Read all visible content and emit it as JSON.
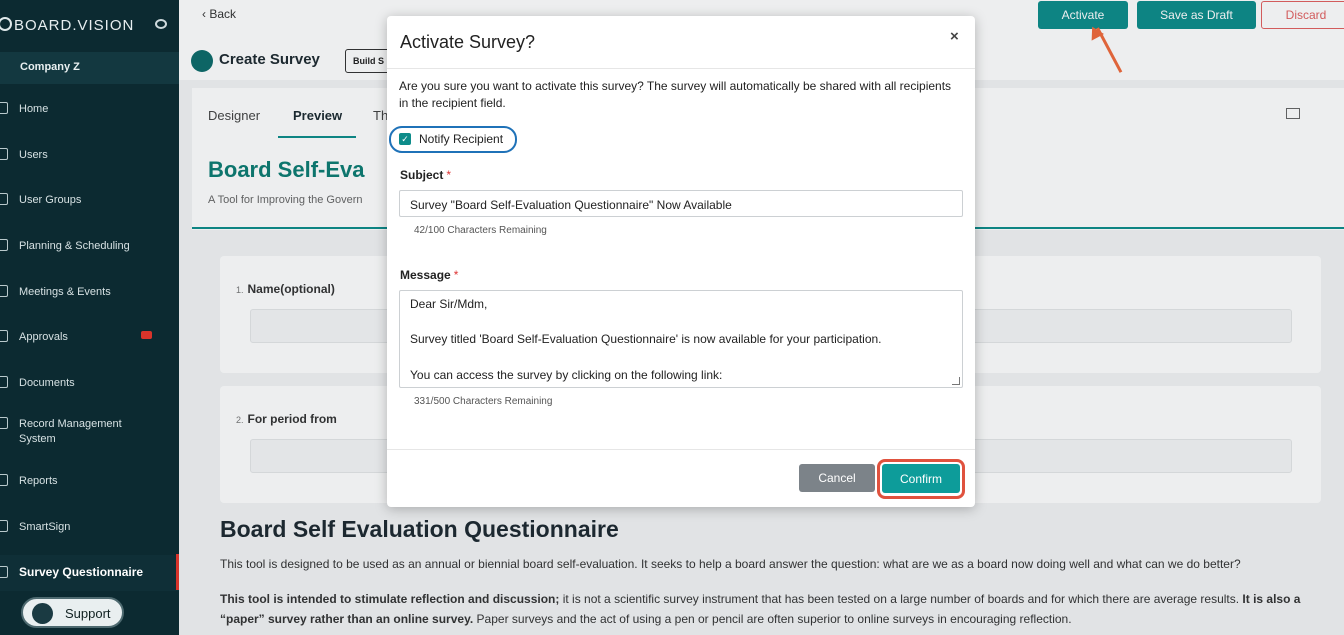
{
  "brand": {
    "name": "BOARD.VISION"
  },
  "sidebar": {
    "company": "Company Z",
    "items": [
      {
        "label": "Home",
        "icon": "home-icon"
      },
      {
        "label": "Users",
        "icon": "user-icon"
      },
      {
        "label": "User Groups",
        "icon": "users-icon"
      },
      {
        "label": "Planning & Scheduling",
        "icon": "chart-icon"
      },
      {
        "label": "Meetings & Events",
        "icon": "calendar-icon"
      },
      {
        "label": "Approvals",
        "icon": "approval-icon",
        "badge": "..."
      },
      {
        "label": "Documents",
        "icon": "document-icon"
      },
      {
        "label": "Record Management System",
        "icon": "record-icon"
      },
      {
        "label": "Reports",
        "icon": "report-icon"
      },
      {
        "label": "SmartSign",
        "icon": "pen-icon"
      },
      {
        "label": "Survey Questionnaire",
        "icon": "survey-icon",
        "active": true
      }
    ],
    "support_label": "Support"
  },
  "topbar": {
    "back_label": "Back",
    "activate_label": "Activate",
    "save_draft_label": "Save as Draft",
    "discard_label": "Discard"
  },
  "header": {
    "title": "Create Survey",
    "build_chip": "Build S"
  },
  "tabs": [
    "Designer",
    "Preview",
    "Th"
  ],
  "survey": {
    "title_partial": "Board Self-Eva",
    "subtitle_partial": "A Tool for Improving the Govern",
    "questions": [
      {
        "number": "1.",
        "label": "Name(optional)"
      },
      {
        "number": "2.",
        "label": "For period from"
      }
    ],
    "doc_title": "Board Self Evaluation Questionnaire",
    "doc_p1": "This tool is designed to be used as an annual or biennial board self-evaluation. It seeks to help a board answer the question: what are we as a board now doing well and what can we do better?",
    "doc_p2_bold1": "This tool is intended to stimulate reflection and discussion;",
    "doc_p2_text1": " it is not a scientific survey instrument that has been tested on a large number of boards and for which there are average results. ",
    "doc_p2_bold2": "It is also a “paper” survey rather than an online survey.",
    "doc_p2_text2": " Paper surveys and the act of using a pen or pencil are often superior to online surveys in encouraging reflection."
  },
  "modal": {
    "title": "Activate Survey?",
    "close": "×",
    "description": "Are you sure you want to activate this survey? The survey will automatically be shared with all recipients in the recipient field.",
    "notify_label": "Notify Recipient",
    "notify_checked": true,
    "subject_label": "Subject",
    "subject_value": "Survey \"Board Self-Evaluation Questionnaire\" Now Available",
    "subject_count": "42/100 Characters Remaining",
    "message_label": "Message",
    "message_lines": [
      "Dear Sir/Mdm,",
      "Survey titled 'Board Self-Evaluation Questionnaire' is now available for your participation.",
      "You can access the survey by clicking on the following link:"
    ],
    "message_count": "331/500 Characters Remaining",
    "required_mark": "*",
    "cancel_label": "Cancel",
    "confirm_label": "Confirm"
  },
  "colors": {
    "sidebar_bg": "#0c2a31",
    "accent": "#0d8c8a",
    "highlight_blue": "#1f72b8",
    "highlight_red": "#e0523e",
    "arrow": "#f06a3b"
  }
}
